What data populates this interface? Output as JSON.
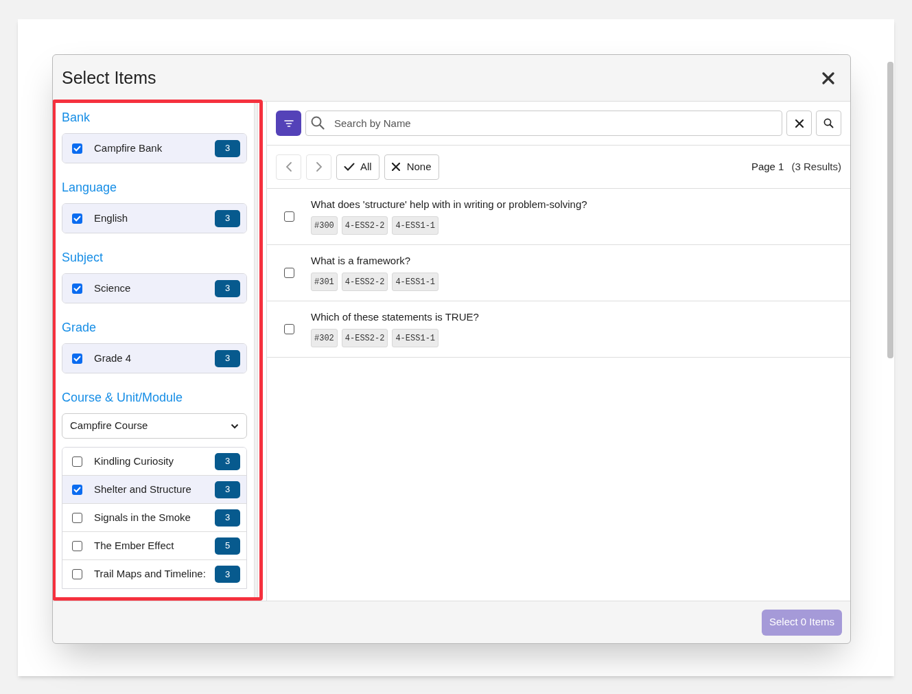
{
  "modal": {
    "title": "Select Items",
    "filters": [
      {
        "heading": "Bank",
        "kind": "checklist",
        "items": [
          {
            "label": "Campfire Bank",
            "count": "3",
            "checked": true
          }
        ]
      },
      {
        "heading": "Language",
        "kind": "checklist",
        "items": [
          {
            "label": "English",
            "count": "3",
            "checked": true
          }
        ]
      },
      {
        "heading": "Subject",
        "kind": "checklist",
        "items": [
          {
            "label": "Science",
            "count": "3",
            "checked": true
          }
        ]
      },
      {
        "heading": "Grade",
        "kind": "checklist",
        "items": [
          {
            "label": "Grade 4",
            "count": "3",
            "checked": true
          }
        ]
      },
      {
        "heading": "Course & Unit/Module",
        "kind": "course",
        "select": "Campfire Course",
        "items": [
          {
            "label": "Kindling Curiosity",
            "count": "3",
            "checked": false
          },
          {
            "label": "Shelter and Structure",
            "count": "3",
            "checked": true
          },
          {
            "label": "Signals in the Smoke",
            "count": "3",
            "checked": false
          },
          {
            "label": "The Ember Effect",
            "count": "5",
            "checked": false
          },
          {
            "label": "Trail Maps and Timeline:",
            "count": "3",
            "checked": false
          }
        ]
      }
    ],
    "search": {
      "placeholder": "Search by Name"
    },
    "nav": {
      "prev_disabled": true,
      "next_disabled": true
    },
    "select_all": "All",
    "select_none": "None",
    "page": "Page 1",
    "results": "(3 Results)",
    "questions": [
      {
        "text": "What does 'structure' help with in writing or problem-solving?",
        "checked": false,
        "tags": [
          "#300",
          "4-ESS2-2",
          "4-ESS1-1"
        ]
      },
      {
        "text": "What is a framework?",
        "checked": false,
        "tags": [
          "#301",
          "4-ESS2-2",
          "4-ESS1-1"
        ]
      },
      {
        "text": "Which of these statements is TRUE?",
        "checked": false,
        "tags": [
          "#302",
          "4-ESS2-2",
          "4-ESS1-1"
        ]
      }
    ],
    "submit": {
      "label": "Select 0 Items",
      "disabled": true
    }
  }
}
